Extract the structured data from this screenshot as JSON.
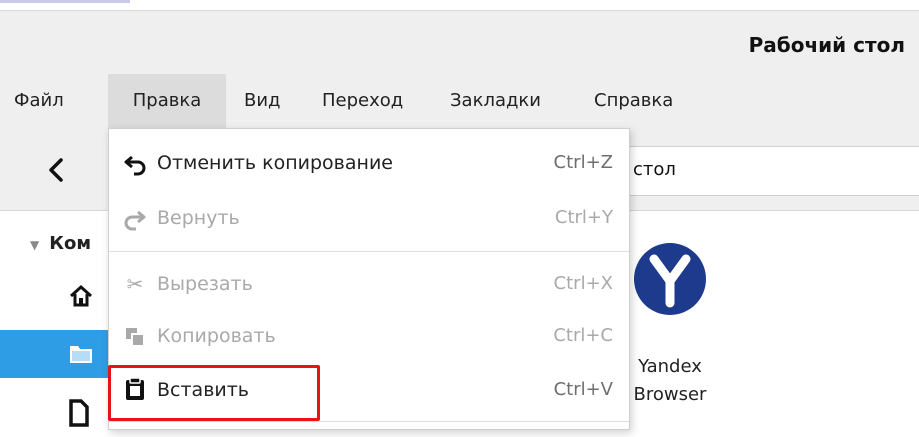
{
  "window": {
    "title": "Рабочий стол"
  },
  "menubar": {
    "items": [
      {
        "label": "Файл"
      },
      {
        "label": "Правка"
      },
      {
        "label": "Вид"
      },
      {
        "label": "Переход"
      },
      {
        "label": "Закладки"
      },
      {
        "label": "Справка"
      }
    ],
    "active_index": 1
  },
  "toolbar": {
    "path_text": "стол"
  },
  "sidebar": {
    "header": "Ком",
    "items": [
      "home-icon",
      "folder-icon",
      "document-icon"
    ]
  },
  "edit_menu": {
    "items": [
      {
        "label": "Отменить копирование",
        "shortcut": "Ctrl+Z",
        "icon": "undo-icon",
        "enabled": true
      },
      {
        "label": "Вернуть",
        "shortcut": "Ctrl+Y",
        "icon": "redo-icon",
        "enabled": false
      },
      {
        "label": "Вырезать",
        "shortcut": "Ctrl+X",
        "icon": "scissors-icon",
        "enabled": false
      },
      {
        "label": "Копировать",
        "shortcut": "Ctrl+C",
        "icon": "copy-icon",
        "enabled": false
      },
      {
        "label": "Вставить",
        "shortcut": "Ctrl+V",
        "icon": "paste-icon",
        "enabled": true
      }
    ]
  },
  "desktop_item": {
    "label_line1": "Yandex",
    "label_line2": "Browser"
  },
  "colors": {
    "selection": "#2f9ce6",
    "highlight_box": "#e8121b",
    "yandex_logo": "#1e3a8c"
  }
}
